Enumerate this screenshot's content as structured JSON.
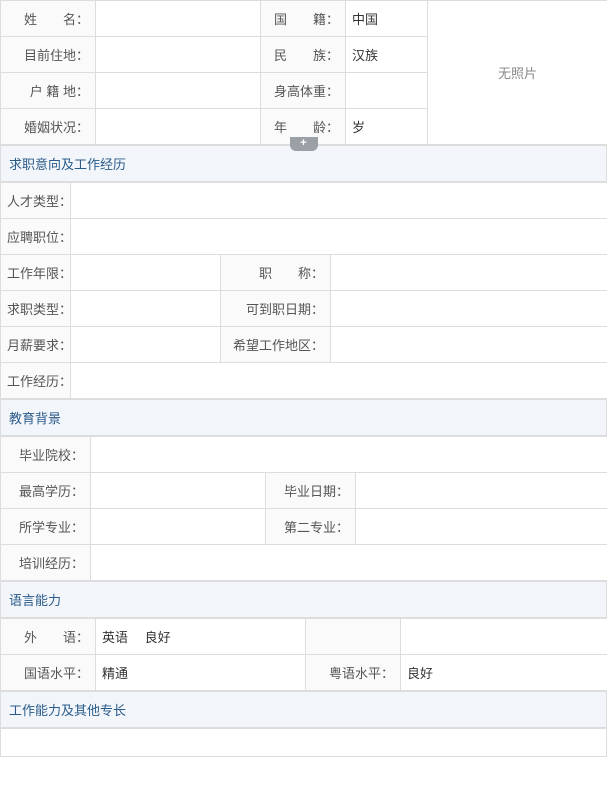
{
  "basic": {
    "name_label": "姓　　名：",
    "name_value": "",
    "nationality_label": "国　　籍：",
    "nationality_value": "中国",
    "residence_label": "目前住地：",
    "residence_value": "",
    "ethnic_label": "民　　族：",
    "ethnic_value": "汉族",
    "huji_label": "户 籍 地：",
    "huji_value": "",
    "height_weight_label": "身高体重：",
    "height_weight_value": "",
    "marital_label": "婚姻状况：",
    "marital_value": "",
    "age_label": "年　　龄：",
    "age_value": "岁",
    "photo_placeholder": "无照片"
  },
  "job_intent": {
    "section_title": "求职意向及工作经历",
    "talent_type_label": "人才类型：",
    "talent_type_value": "",
    "position_label": "应聘职位：",
    "position_value": "",
    "work_years_label": "工作年限：",
    "work_years_value": "",
    "title_label": "职　　称：",
    "title_value": "",
    "job_type_label": "求职类型：",
    "job_type_value": "",
    "avail_date_label": "可到职日期：",
    "avail_date_value": "",
    "salary_label": "月薪要求：",
    "salary_value": "",
    "work_area_label": "希望工作地区：",
    "work_area_value": "",
    "work_exp_label": "工作经历：",
    "work_exp_value": ""
  },
  "education": {
    "section_title": "教育背景",
    "school_label": "毕业院校：",
    "school_value": "",
    "degree_label": "最高学历：",
    "degree_value": "",
    "grad_date_label": "毕业日期：",
    "grad_date_value": "",
    "major_label": "所学专业：",
    "major_value": "",
    "second_major_label": "第二专业：",
    "second_major_value": "",
    "training_label": "培训经历：",
    "training_value": ""
  },
  "language": {
    "section_title": "语言能力",
    "foreign_label": "外　　语：",
    "foreign_value": "英语　 良好",
    "foreign_value2": "",
    "mandarin_label": "国语水平：",
    "mandarin_value": "精通",
    "cantonese_label": "粤语水平：",
    "cantonese_value": "良好"
  },
  "ability": {
    "section_title": "工作能力及其他专长"
  },
  "icons": {
    "plus": "+"
  }
}
